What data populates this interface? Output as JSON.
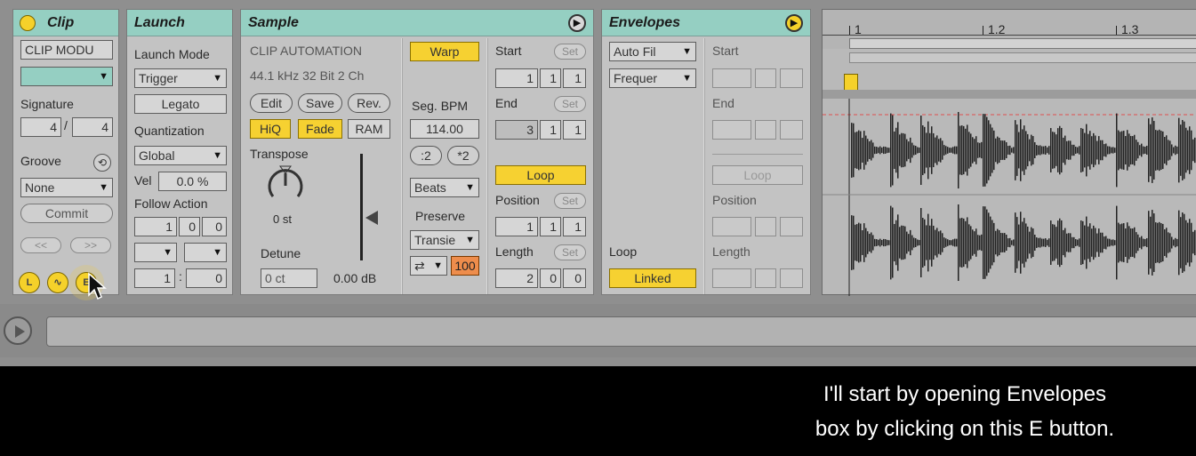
{
  "clip": {
    "title": "Clip",
    "name": "CLIP MODU",
    "color_value": "",
    "signature_label": "Signature",
    "sig_num": "4",
    "sig_den": "4",
    "groove_label": "Groove",
    "groove_value": "None",
    "commit_label": "Commit",
    "nudge_back": "<<",
    "nudge_fwd": ">>",
    "buttons": [
      "L",
      "",
      "E"
    ]
  },
  "launch": {
    "title": "Launch",
    "mode_label": "Launch Mode",
    "mode_value": "Trigger",
    "legato_label": "Legato",
    "quant_label": "Quantization",
    "quant_value": "Global",
    "vel_label": "Vel",
    "vel_value": "0.0 %",
    "follow_label": "Follow Action",
    "follow_a": "1",
    "follow_b": "0",
    "follow_c": "0",
    "chance_a": "1",
    "chance_b": "0"
  },
  "sample": {
    "title": "Sample",
    "name": "CLIP AUTOMATION",
    "info": "44.1 kHz 32 Bit 2 Ch",
    "edit": "Edit",
    "save": "Save",
    "rev": "Rev.",
    "hiq": "HiQ",
    "fade": "Fade",
    "ram": "RAM",
    "transpose_label": "Transpose",
    "transpose_value": "0 st",
    "detune_label": "Detune",
    "detune_value": "0 ct",
    "gain_value": "0.00 dB",
    "warp": "Warp",
    "seg_bpm_label": "Seg. BPM",
    "seg_bpm_value": "114.00",
    "half": ":2",
    "double": "*2",
    "warp_mode": "Beats",
    "preserve_label": "Preserve",
    "preserve_value": "Transie",
    "loop_mode_value": "⇄",
    "envelope_value": "100",
    "start_label": "Start",
    "start": [
      "1",
      "1",
      "1"
    ],
    "end_label": "End",
    "end": [
      "3",
      "1",
      "1"
    ],
    "set": "Set",
    "loop": "Loop",
    "position_label": "Position",
    "position": [
      "1",
      "1",
      "1"
    ],
    "length_label": "Length",
    "length": [
      "2",
      "0",
      "0"
    ]
  },
  "envelopes": {
    "title": "Envelopes",
    "device_value": "Auto Fil",
    "control_value": "Frequer",
    "loop_label": "Loop",
    "linked": "Linked",
    "start_label": "Start",
    "end_label": "End",
    "loop_button": "Loop",
    "position_label": "Position",
    "length_label": "Length"
  },
  "ruler": {
    "ticks": [
      "1",
      "1.2",
      "1.3"
    ]
  },
  "caption": {
    "line1": "I'll start by opening Envelopes",
    "line2": "box by clicking on this E button."
  },
  "colors": {
    "header": "#95cfc2",
    "accent": "#f6d131",
    "orange": "#ee8d4c",
    "panel": "#c3c3c3"
  },
  "icons": [
    "arrow-right-icon",
    "hotswap-icon",
    "play-icon",
    "cursor-icon"
  ]
}
